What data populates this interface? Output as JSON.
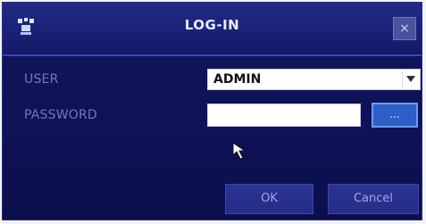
{
  "dialog": {
    "title": "LOG-IN",
    "close_label": "×",
    "icon": "user-group-icon"
  },
  "fields": {
    "user_label": "USER",
    "user_value": "ADMIN",
    "password_label": "PASSWORD",
    "password_value": "",
    "keyboard_button_label": "...",
    "dropdown_icon": "chevron-down-icon"
  },
  "buttons": {
    "ok_label": "OK",
    "cancel_label": "Cancel"
  },
  "colors": {
    "dialog_background": "#10145a",
    "titlebar": "#1a2178",
    "label_text": "#6f79c9",
    "accent_button": "#2e5ec7"
  }
}
